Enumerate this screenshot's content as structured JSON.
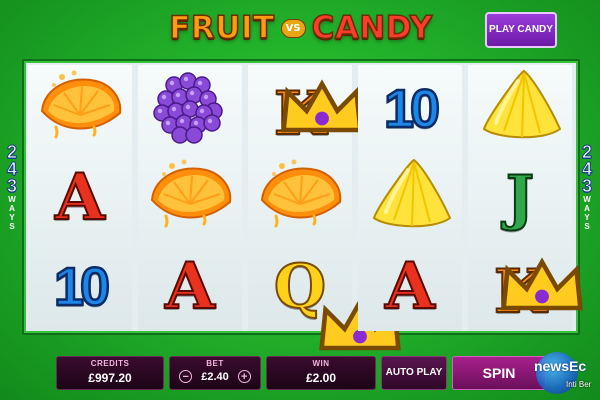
{
  "title": {
    "word1": "FRUIT",
    "vs": "VS",
    "word2": "CANDY"
  },
  "play_candy_button": "PLAY CANDY",
  "ways": {
    "number": [
      "2",
      "4",
      "3"
    ],
    "label": [
      "W",
      "A",
      "Y",
      "S"
    ]
  },
  "reels": [
    [
      {
        "symbol": "orange-slice"
      },
      {
        "symbol": "card-a",
        "text": "A"
      },
      {
        "symbol": "card-10",
        "text": "10"
      }
    ],
    [
      {
        "symbol": "purple-berry"
      },
      {
        "symbol": "orange-slice"
      },
      {
        "symbol": "card-a",
        "text": "A"
      }
    ],
    [
      {
        "symbol": "card-k",
        "text": "K"
      },
      {
        "symbol": "orange-slice"
      },
      {
        "symbol": "card-q",
        "text": "Q"
      }
    ],
    [
      {
        "symbol": "card-10",
        "text": "10"
      },
      {
        "symbol": "yellow-candy"
      },
      {
        "symbol": "card-a",
        "text": "A"
      }
    ],
    [
      {
        "symbol": "yellow-candy"
      },
      {
        "symbol": "card-j",
        "text": "J"
      },
      {
        "symbol": "card-k",
        "text": "K"
      }
    ]
  ],
  "controls": {
    "credits_label": "CREDITS",
    "credits_value": "£997.20",
    "bet_label": "BET",
    "bet_value": "£2.40",
    "bet_minus": "−",
    "bet_plus": "+",
    "win_label": "WIN",
    "win_value": "£2.00",
    "auto_play": "AUTO PLAY",
    "spin": "SPIN"
  },
  "watermark": {
    "text": "newsEc",
    "sub": "Inti Ber"
  },
  "colors": {
    "background": "#22b22a",
    "reel_bg": "#e4eef0",
    "spin_button": "#a8208e",
    "panel": "#2a0822"
  }
}
